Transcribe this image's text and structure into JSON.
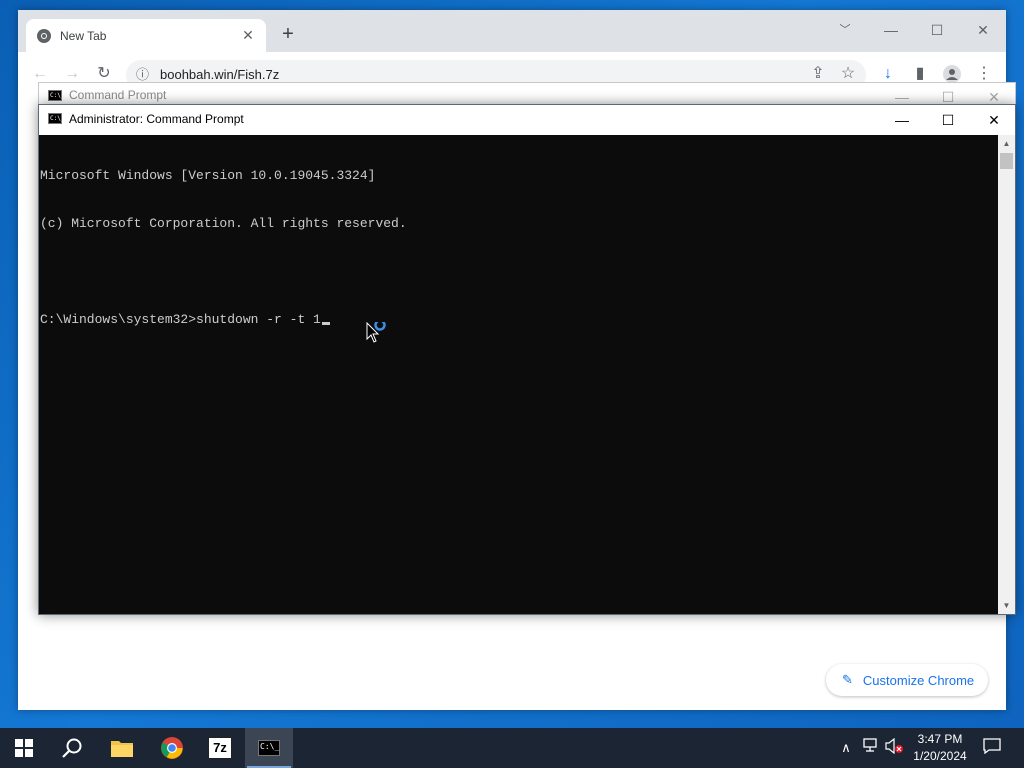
{
  "chrome": {
    "tab_title": "New Tab",
    "url": "boohbah.win/Fish.7z",
    "customize_label": "Customize Chrome",
    "icons": [
      "chrome-favicon",
      "close-icon",
      "plus-icon",
      "back-icon",
      "forward-icon",
      "reload-icon",
      "info-icon",
      "share-icon",
      "star-icon",
      "download-icon",
      "side-panel-icon",
      "profile-icon",
      "menu-icon",
      "pencil-icon"
    ]
  },
  "cmd_background": {
    "title": "Command Prompt"
  },
  "cmd": {
    "title": "Administrator: Command Prompt",
    "lines": [
      "Microsoft Windows [Version 10.0.19045.3324]",
      "(c) Microsoft Corporation. All rights reserved.",
      "",
      "C:\\Windows\\system32>shutdown -r -t 1"
    ],
    "title_icon_text": "C:\\_"
  },
  "taskbar": {
    "apps": [
      "windows-start",
      "search",
      "file-explorer",
      "chrome",
      "7-zip",
      "command-prompt"
    ],
    "seven_zip_label": "7z",
    "time": "3:47 PM",
    "date": "1/20/2024"
  },
  "colors": {
    "desktop": "#0a5fb4",
    "console_bg": "#0c0c0c",
    "console_text": "#cccccc",
    "chrome_accent": "#1a73e8",
    "taskbar": "#1c2533"
  }
}
